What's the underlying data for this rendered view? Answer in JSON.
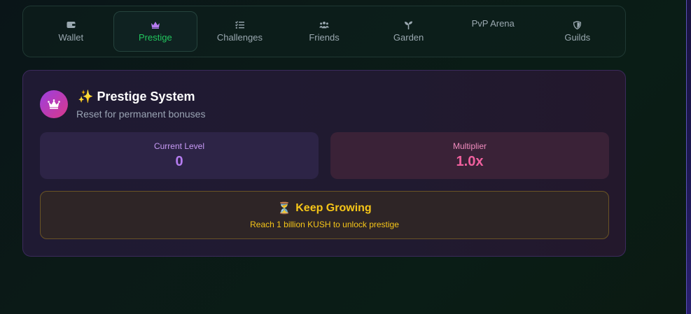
{
  "tabs": [
    {
      "label": "Wallet",
      "icon": "wallet-icon"
    },
    {
      "label": "Prestige",
      "icon": "crown-icon",
      "active": true
    },
    {
      "label": "Challenges",
      "icon": "checklist-icon"
    },
    {
      "label": "Friends",
      "icon": "users-icon"
    },
    {
      "label": "Garden",
      "icon": "sprout-icon"
    },
    {
      "label": "PvP Arena",
      "icon": ""
    },
    {
      "label": "Guilds",
      "icon": "shield-icon"
    }
  ],
  "prestige": {
    "title_emoji": "✨",
    "title": "Prestige System",
    "subtitle": "Reset for permanent bonuses",
    "level_label": "Current Level",
    "level_value": "0",
    "multiplier_label": "Multiplier",
    "multiplier_value": "1.0x",
    "notice_emoji": "⏳",
    "notice_title": "Keep Growing",
    "notice_text": "Reach 1 billion KUSH to unlock prestige"
  },
  "colors": {
    "accent_green": "#22c55e",
    "prestige_purple": "#b57cf0",
    "prestige_pink": "#f0609e",
    "notice_gold": "#f5c518"
  }
}
